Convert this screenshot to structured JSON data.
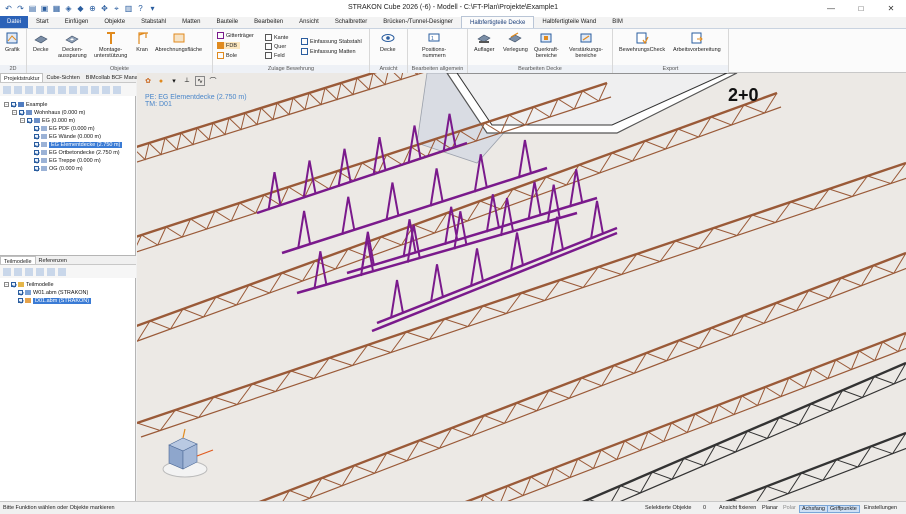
{
  "window": {
    "title": "STRAKON Cube 2026 (-6) - Modell - C:\\FT-Plan\\Projekte\\Example1",
    "minimize": "—",
    "maximize": "□",
    "close": "✕"
  },
  "tabs": [
    "Datei",
    "Start",
    "Einfügen",
    "Objekte",
    "Stabstahl",
    "Matten",
    "Bauteile",
    "Bearbeiten",
    "Ansicht",
    "Schalbretter",
    "Brücken-/Tunnel-Designer",
    "Halbfertigteile Decke",
    "Halbfertigteile Wand",
    "BIM"
  ],
  "active_tab": "Halbfertigteile Decke",
  "ribbon": {
    "g2d": {
      "label": "2D",
      "grafik": "Grafik"
    },
    "objekte": {
      "label": "Objekte",
      "decke": "Decke",
      "deckenaussparung": "Decken-\naussparung",
      "montage": "Montage-\nunterstützung",
      "kran": "Kran",
      "abrechnung": "Abrechnungsfläche"
    },
    "zulage": {
      "label": "Zulage Bewehrung",
      "gittertraeger": "Gitterträger",
      "fdb": "FDB",
      "bole": "Bole",
      "kante": "Kante",
      "quer": "Quer",
      "feld": "Feld",
      "einf_stab": "Einfassung Stabstahl",
      "einf_matten": "Einfassung Matten"
    },
    "ansicht": {
      "label": "Ansicht",
      "decke": "Decke"
    },
    "bearb_allg": {
      "label": "Bearbeiten allgemein",
      "positions": "Positions-\nnummern"
    },
    "bearb_decke": {
      "label": "Bearbeiten Decke",
      "auflager": "Auflager",
      "verlegung": "Verlegung",
      "querkraft": "Querkraft-\nbereiche",
      "verstaerkung": "Verstärkungs-\nbereiche"
    },
    "export": {
      "label": "Export",
      "bewehrungscheck": "BewehrungsCheck",
      "arbeitsvorb": "Arbeitsvorbereitung"
    }
  },
  "panel_top": {
    "tabs": [
      "Projektstruktur",
      "Cube-Sichten",
      "BIMcollab BCF Manager"
    ],
    "tree": [
      {
        "label": "Example",
        "level": 0
      },
      {
        "label": "Wohnhaus (0.000 m)",
        "level": 1
      },
      {
        "label": "EG (0.000 m)",
        "level": 2
      },
      {
        "label": "EG PDF (0.000 m)",
        "level": 3
      },
      {
        "label": "EG Wände (0.000 m)",
        "level": 3
      },
      {
        "label": "EG Elementdecke (2.750 m)",
        "level": 3,
        "selected": true
      },
      {
        "label": "EG Ortbetondecke (2.750 m)",
        "level": 3
      },
      {
        "label": "EG Treppe (0.000 m)",
        "level": 3
      },
      {
        "label": "OG (0.000 m)",
        "level": 3
      }
    ]
  },
  "panel_bottom": {
    "tabs": [
      "Teilmodelle",
      "Referenzen"
    ],
    "tree": [
      {
        "label": "Teilmodelle",
        "level": 0
      },
      {
        "label": "W01.abm (STRAKON)",
        "level": 1
      },
      {
        "label": "D01.abm (STRAKON)",
        "level": 1,
        "selected": true
      }
    ]
  },
  "viewport": {
    "label_line1": "PE: EG Elementdecke (2.750 m)",
    "label_line2": "TM: D01",
    "axis_text": "2+0"
  },
  "status": {
    "prompt": "Bitte Funktion wählen oder Objekte markieren",
    "selected_label": "Selektierte Objekte",
    "selected_count": "0",
    "ansicht_fixieren": "Ansicht fixieren",
    "planar": "Planar",
    "polar": "Polar",
    "achsfang": "Achsfang",
    "griffpunkte": "Griffpunkte",
    "einstellungen": "Einstellungen"
  },
  "colors": {
    "accent": "#2b62b8",
    "rebar_brown": "#9a5a38",
    "lattice_purple": "#7a1a8c",
    "viewport_bg": "#ece9e5"
  }
}
